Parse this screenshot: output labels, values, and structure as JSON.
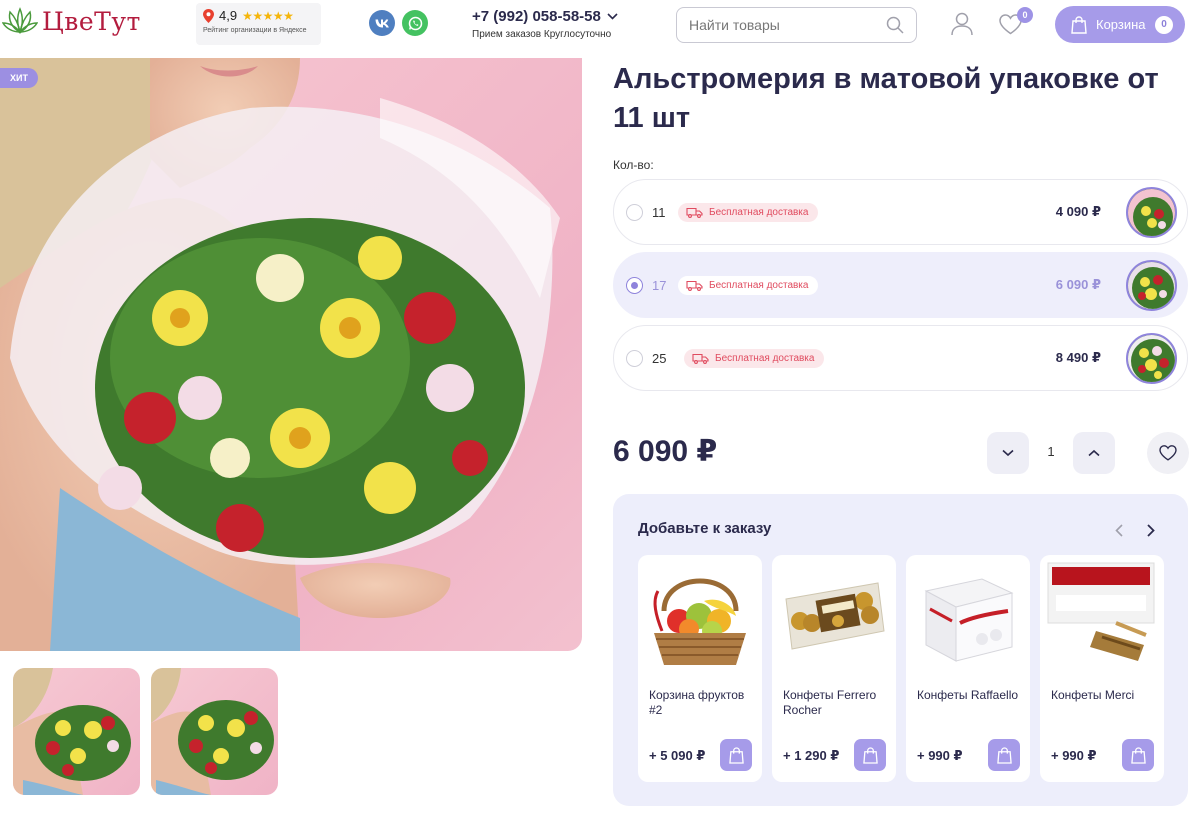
{
  "header": {
    "logo_text": "ЦвеТут",
    "rating_value": "4,9",
    "rating_stars": "★★★★★",
    "rating_caption": "Рейтинг организации в Яндексе",
    "social": {
      "vk": "vk",
      "whatsapp": "whatsapp"
    },
    "phone": "+7 (992) 058-58-58",
    "phone_subtitle": "Прием заказов Круглосуточно",
    "search_placeholder": "Найти товары",
    "favorites_count": "0",
    "cart_label": "Корзина",
    "cart_count": "0"
  },
  "product": {
    "badge": "ХИТ",
    "title": "Альстромерия в матовой упаковке от 11 шт",
    "quantity_label": "Кол-во:",
    "options": [
      {
        "count": "11",
        "delivery": "Бесплатная доставка",
        "price": "4 090 ₽",
        "selected": false
      },
      {
        "count": "17",
        "delivery": "Бесплатная доставка",
        "price": "6 090 ₽",
        "selected": true
      },
      {
        "count": "25",
        "delivery": "Бесплатная доставка",
        "price": "8 490 ₽",
        "selected": false
      }
    ],
    "price": "6 090 ₽",
    "quantity": "1"
  },
  "addons": {
    "title": "Добавьте к заказу",
    "items": [
      {
        "name": "Корзина фруктов #2",
        "price": "+ 5 090 ₽"
      },
      {
        "name": "Конфеты Ferrero Rocher",
        "price": "+ 1 290 ₽"
      },
      {
        "name": "Конфеты Raffaello",
        "price": "+ 990 ₽"
      },
      {
        "name": "Конфеты Merci",
        "price": "+ 990 ₽"
      }
    ]
  },
  "colors": {
    "accent": "#a69be9",
    "text_dark": "#2b2a4c",
    "logo": "#b31c3e",
    "delivery_text": "#e04b5f"
  }
}
